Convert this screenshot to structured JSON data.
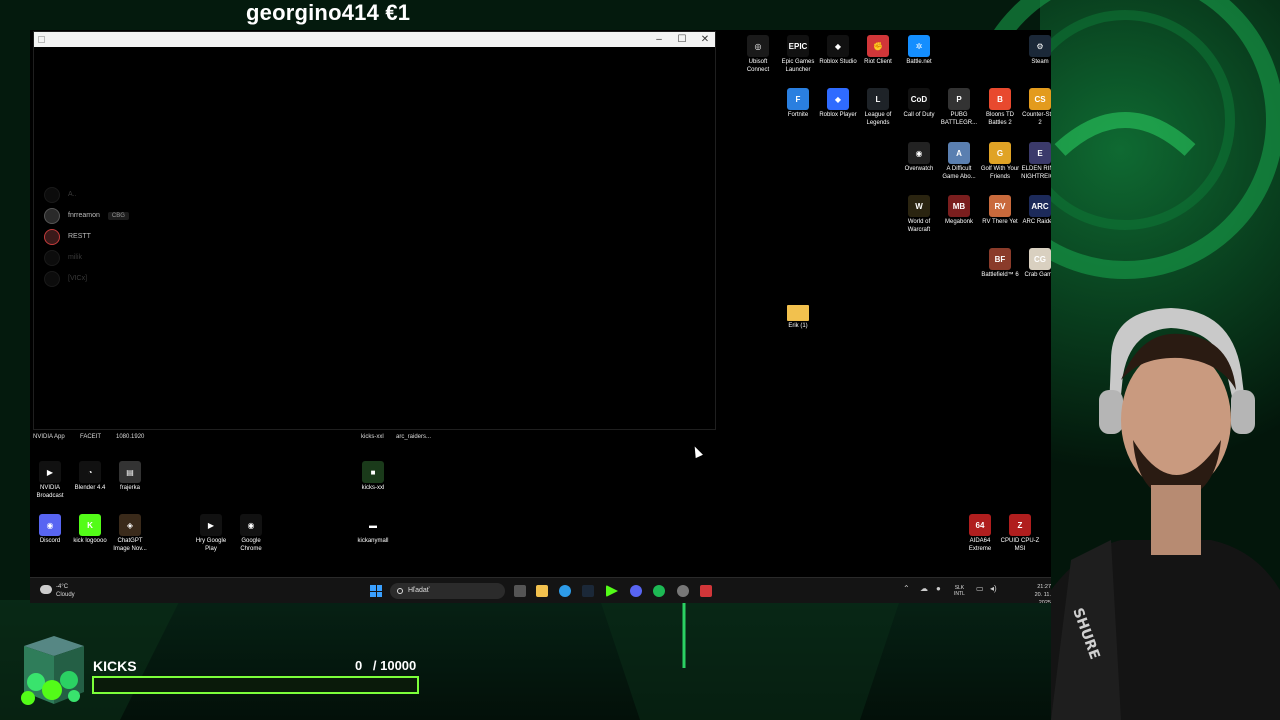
{
  "overlay": {
    "donation": "georgino414 €1",
    "goal": {
      "label": "KICKS",
      "current": "0",
      "separator": "/",
      "target": "10000",
      "progress": 0
    }
  },
  "window": {
    "friends": [
      {
        "name": "A..",
        "tag": "",
        "dim": true
      },
      {
        "name": "fnrreamon",
        "tag": "CBG",
        "dim": false
      },
      {
        "name": "RESTT",
        "tag": "",
        "dim": false,
        "red": true
      },
      {
        "name": "milik",
        "tag": "",
        "dim": true
      },
      {
        "name": "[VICx]",
        "tag": "",
        "dim": true
      }
    ]
  },
  "desktop_icons": [
    {
      "id": "ubisoft",
      "label": "Ubisoft Connect",
      "color": "#1a1a1a",
      "glyph": "◎"
    },
    {
      "id": "epic",
      "label": "Epic Games Launcher",
      "color": "#111111",
      "glyph": "EPIC"
    },
    {
      "id": "roblox-studio",
      "label": "Roblox Studio",
      "color": "#111111",
      "glyph": "◆"
    },
    {
      "id": "riot",
      "label": "Riot Client",
      "color": "#d13639",
      "glyph": "✊"
    },
    {
      "id": "battlenet",
      "label": "Battle.net",
      "color": "#148eff",
      "glyph": "✲"
    },
    {
      "id": "steam",
      "label": "Steam",
      "color": "#1b2838",
      "glyph": "⚙"
    },
    {
      "id": "fortnite",
      "label": "Fortnite",
      "color": "#2a7fe0",
      "glyph": "F"
    },
    {
      "id": "roblox-player",
      "label": "Roblox Player",
      "color": "#2f6bff",
      "glyph": "◆"
    },
    {
      "id": "lol",
      "label": "League of Legends",
      "color": "#1e2328",
      "glyph": "L"
    },
    {
      "id": "cod",
      "label": "Call of Duty",
      "color": "#111111",
      "glyph": "CoD"
    },
    {
      "id": "pubg",
      "label": "PUBG BATTLEGR...",
      "color": "#333333",
      "glyph": "P"
    },
    {
      "id": "btd",
      "label": "Bloons TD Battles 2",
      "color": "#e8492e",
      "glyph": "B"
    },
    {
      "id": "cs2",
      "label": "Counter-Str... 2",
      "color": "#e39b1d",
      "glyph": "CS"
    },
    {
      "id": "overwatch",
      "label": "Overwatch",
      "color": "#222222",
      "glyph": "◉"
    },
    {
      "id": "difficult",
      "label": "A Difficult Game Abo...",
      "color": "#5a7fb0",
      "glyph": "A"
    },
    {
      "id": "golf",
      "label": "Golf With Your Friends",
      "color": "#e0a325",
      "glyph": "G"
    },
    {
      "id": "elden",
      "label": "ELDEN RING NIGHTREIGN",
      "color": "#3b3a6b",
      "glyph": "E"
    },
    {
      "id": "wow",
      "label": "World of Warcraft",
      "color": "#2a2410",
      "glyph": "W"
    },
    {
      "id": "megabonk",
      "label": "Megabonk",
      "color": "#7a1e1e",
      "glyph": "MB"
    },
    {
      "id": "rv",
      "label": "RV There Yet",
      "color": "#c96a3c",
      "glyph": "RV"
    },
    {
      "id": "arc",
      "label": "ARC Raiders",
      "color": "#1c2a5a",
      "glyph": "ARC"
    },
    {
      "id": "bf6",
      "label": "Battlefield™ 6",
      "color": "#8a3b2a",
      "glyph": "BF"
    },
    {
      "id": "crab",
      "label": "Crab Game",
      "color": "#d9d0c0",
      "glyph": "CG"
    },
    {
      "id": "erik",
      "label": "Erik (1)",
      "color": "#f2c14e",
      "glyph": ""
    },
    {
      "id": "nvidia-broadcast",
      "label": "NVIDIA Broadcast",
      "color": "#111111",
      "glyph": "▶"
    },
    {
      "id": "blender",
      "label": "Blender 4.4",
      "color": "#111111",
      "glyph": "◔"
    },
    {
      "id": "frajerka",
      "label": "frajerka",
      "color": "#333333",
      "glyph": "▤"
    },
    {
      "id": "kicks-xxl",
      "label": "kicks-xxl",
      "color": "#1a3a1a",
      "glyph": "■"
    },
    {
      "id": "discord",
      "label": "Discord",
      "color": "#5865f2",
      "glyph": "◉"
    },
    {
      "id": "kick-logo",
      "label": "kick logoooo",
      "color": "#53fc18",
      "glyph": "K"
    },
    {
      "id": "chatgpt",
      "label": "ChatGPT Image Nov...",
      "color": "#3a2a1a",
      "glyph": "◈"
    },
    {
      "id": "google-play",
      "label": "Hry Google Play",
      "color": "#111111",
      "glyph": "▶"
    },
    {
      "id": "chrome",
      "label": "Google Chrome",
      "color": "#111111",
      "glyph": "◉"
    },
    {
      "id": "kickanymall",
      "label": "kickanymall",
      "color": "#000000",
      "glyph": "▬"
    },
    {
      "id": "aida64",
      "label": "AIDA64 Extreme",
      "color": "#b01e1e",
      "glyph": "64"
    },
    {
      "id": "cpuid",
      "label": "CPUID CPU-Z MSI",
      "color": "#b01e1e",
      "glyph": "Z"
    }
  ],
  "desktop_text_labels": [
    "NVIDIA App",
    "FACEIT",
    "1080.1920",
    "kicks-xxl",
    "arc_raiders..."
  ],
  "taskbar": {
    "weather_temp": "-4°C",
    "weather_desc": "Cloudy",
    "search_placeholder": "Hľadať",
    "lang_top": "SLK",
    "lang_bottom": "INTL",
    "time": "21:27",
    "date": "20. 11. 2025"
  },
  "colors": {
    "accent_green": "#7cff3a",
    "kick_green": "#53fc18",
    "bg_green": "#0b3a1e"
  }
}
